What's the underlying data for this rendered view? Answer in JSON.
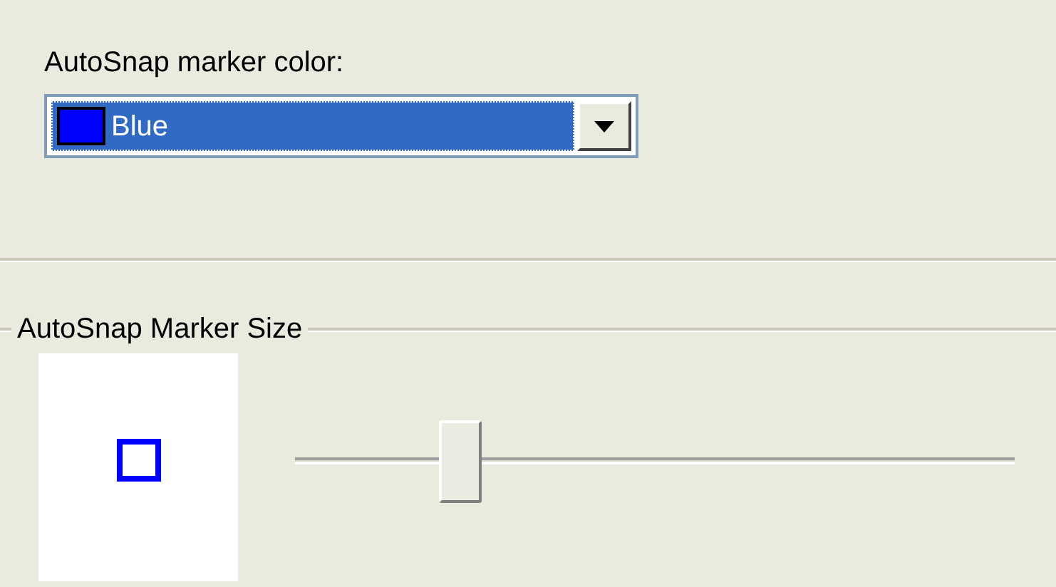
{
  "marker_color": {
    "label": "AutoSnap marker color:",
    "value": "Blue",
    "color": "#0000ff"
  },
  "marker_size": {
    "title": "AutoSnap Marker Size",
    "level": 0.23
  }
}
